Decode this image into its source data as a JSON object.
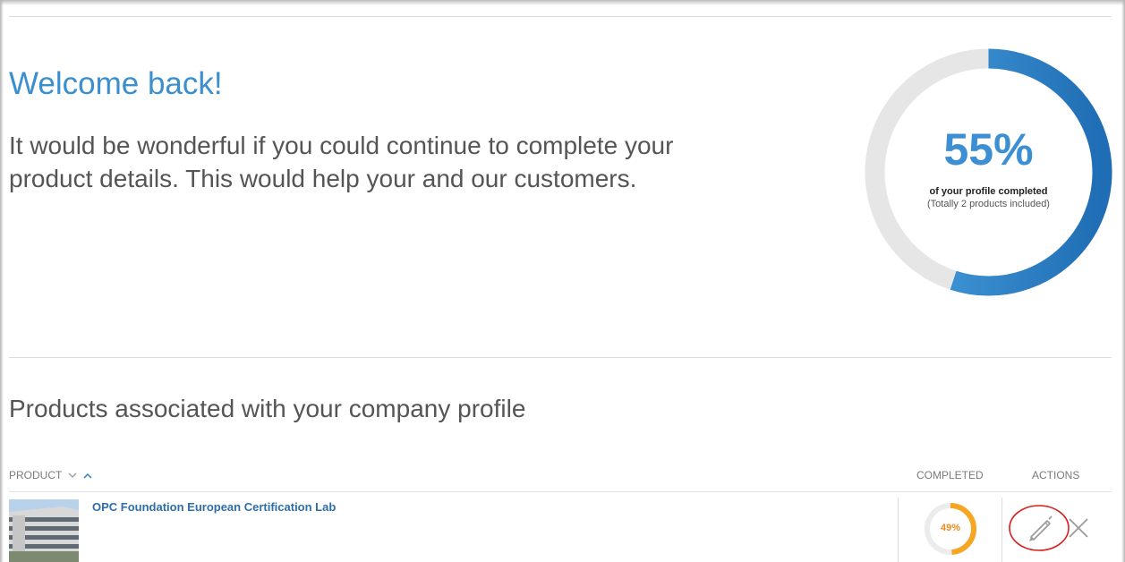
{
  "welcome": {
    "title": "Welcome back!",
    "message": "It would be wonderful if you could continue to complete your product details. This would help your and our customers."
  },
  "profile_progress": {
    "percent_label": "55%",
    "percent": 55,
    "caption": "of your profile completed",
    "subcaption": "(Totally 2 products included)",
    "track_color": "#e6e6e6",
    "fill_color": "#3d8fd4"
  },
  "products": {
    "heading": "Products associated with your company profile",
    "columns": {
      "product": "PRODUCT",
      "completed": "COMPLETED",
      "actions": "ACTIONS"
    },
    "sort_icons": [
      "chevron-down-icon",
      "chevron-up-icon"
    ],
    "rows": [
      {
        "name": "OPC Foundation European Certification Lab",
        "completed_label": "49%",
        "completed": 49,
        "completed_color": "#f5a623",
        "actions": [
          "pencil-icon",
          "close-icon"
        ]
      }
    ]
  }
}
